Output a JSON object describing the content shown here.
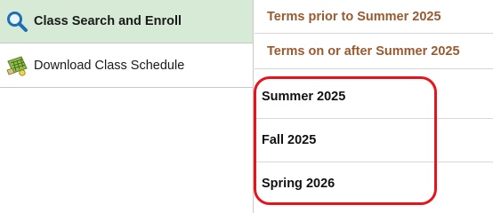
{
  "nav": {
    "items": [
      {
        "label": "Class Search and Enroll",
        "icon": "magnifier-search-icon",
        "selected": true
      },
      {
        "label": "Download Class Schedule",
        "icon": "calendar-download-icon",
        "selected": false
      }
    ]
  },
  "terms": {
    "headers": [
      "Terms prior to Summer 2025",
      "Terms on or after Summer 2025"
    ],
    "options": [
      "Summer 2025",
      "Fall 2025",
      "Spring 2026"
    ]
  },
  "colors": {
    "selected_bg": "#d6ead6",
    "header_text": "#9a5a2e",
    "highlight": "#e8141c",
    "search_icon": "#1d6fb5"
  }
}
